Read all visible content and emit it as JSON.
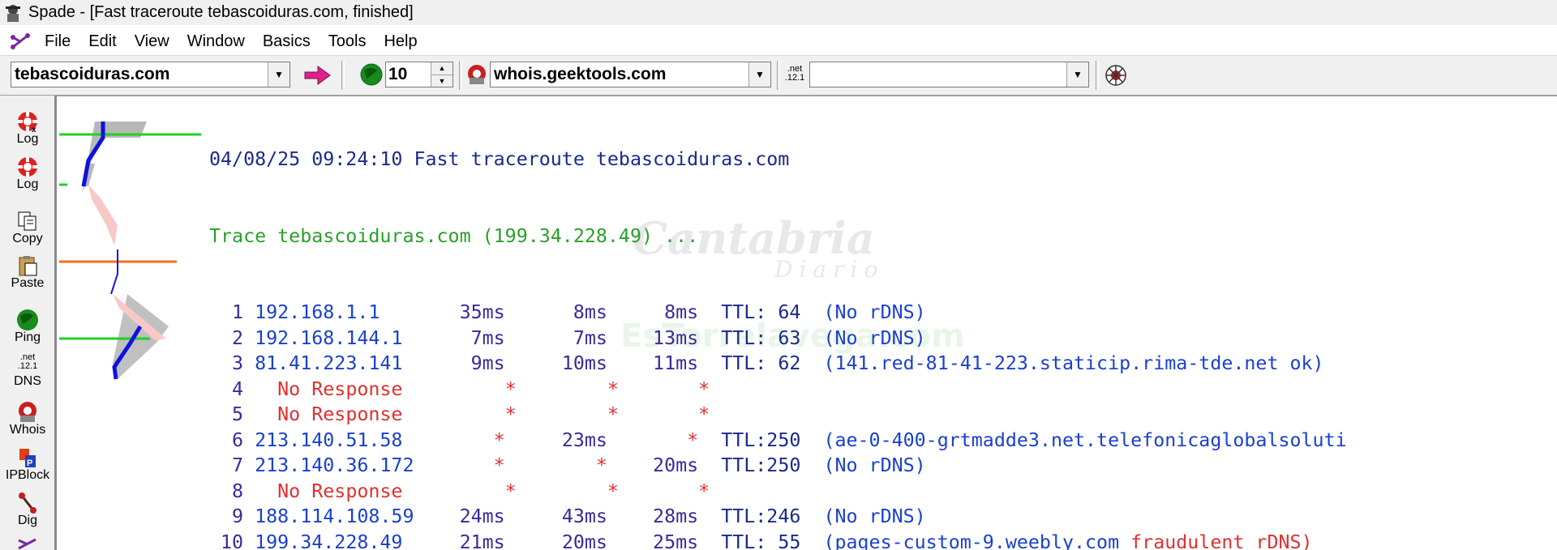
{
  "window": {
    "title": "Spade - [Fast traceroute tebascoiduras.com, finished]"
  },
  "menu": [
    "File",
    "Edit",
    "View",
    "Window",
    "Basics",
    "Tools",
    "Help"
  ],
  "toolbar": {
    "host_value": "tebascoiduras.com",
    "count_value": "10",
    "whois_server": "whois.geektools.com",
    "dns_value": "",
    "dns_icon_text": ".net .12.1"
  },
  "sidebar": [
    {
      "label": "Log",
      "icon": "lifebuoy-x-icon"
    },
    {
      "label": "Log",
      "icon": "lifebuoy-icon"
    },
    {
      "label": "Copy",
      "icon": "copy-icon"
    },
    {
      "label": "Paste",
      "icon": "paste-icon"
    },
    {
      "label": "Ping",
      "icon": "ping-globe-icon"
    },
    {
      "label": "DNS",
      "icon": "dns-icon"
    },
    {
      "label": "Whois",
      "icon": "whois-icon"
    },
    {
      "label": "IPBlock",
      "icon": "ipblock-icon"
    },
    {
      "label": "Dig",
      "icon": "dig-icon"
    }
  ],
  "log": {
    "header": "04/08/25 09:24:10 Fast traceroute tebascoiduras.com",
    "trace": "Trace tebascoiduras.com (199.34.228.49) ...",
    "hops": [
      {
        "n": " 1",
        "ip": "192.168.1.1",
        "t1": "35ms",
        "t2": "8ms",
        "t3": "8ms",
        "ttl": "TTL: 64",
        "rdns": "(No rDNS)"
      },
      {
        "n": " 2",
        "ip": "192.168.144.1",
        "t1": "7ms",
        "t2": "7ms",
        "t3": "13ms",
        "ttl": "TTL: 63",
        "rdns": "(No rDNS)"
      },
      {
        "n": " 3",
        "ip": "81.41.223.141",
        "t1": "9ms",
        "t2": "10ms",
        "t3": "11ms",
        "ttl": "TTL: 62",
        "rdns": "(141.red-81-41-223.staticip.rima-tde.net ok)"
      },
      {
        "n": " 4",
        "noresp": "No Response",
        "t1": "*",
        "t2": "*",
        "t3": "*"
      },
      {
        "n": " 5",
        "noresp": "No Response",
        "t1": "*",
        "t2": "*",
        "t3": "*"
      },
      {
        "n": " 6",
        "ip": "213.140.51.58",
        "t1": "*",
        "t2": "23ms",
        "t3": "*",
        "ttl": "TTL:250",
        "rdns": "(ae-0-400-grtmadde3.net.telefonicaglobalsoluti"
      },
      {
        "n": " 7",
        "ip": "213.140.36.172",
        "t1": "*",
        "t2": "*",
        "t3": "20ms",
        "ttl": "TTL:250",
        "rdns": "(No rDNS)"
      },
      {
        "n": " 8",
        "noresp": "No Response",
        "t1": "*",
        "t2": "*",
        "t3": "*"
      },
      {
        "n": " 9",
        "ip": "188.114.108.59",
        "t1": "24ms",
        "t2": "43ms",
        "t3": "28ms",
        "ttl": "TTL:246",
        "rdns": "(No rDNS)"
      },
      {
        "n": "10",
        "ip": "199.34.228.49",
        "t1": "21ms",
        "t2": "20ms",
        "t3": "25ms",
        "ttl": "TTL: 55",
        "rdns_a": "(pages-custom-9.weebly.com",
        "rdns_b": "fraudulent rDNS)"
      }
    ]
  },
  "watermark": {
    "line1": "Cantabria",
    "line2": "Diario",
    "line3": "EsTorrelavega.com"
  },
  "colors": {
    "navy": "#1a2a8a",
    "blue": "#1a40d0",
    "green": "#2aa02a",
    "red": "#e03030",
    "purple": "#3a2a9a"
  }
}
